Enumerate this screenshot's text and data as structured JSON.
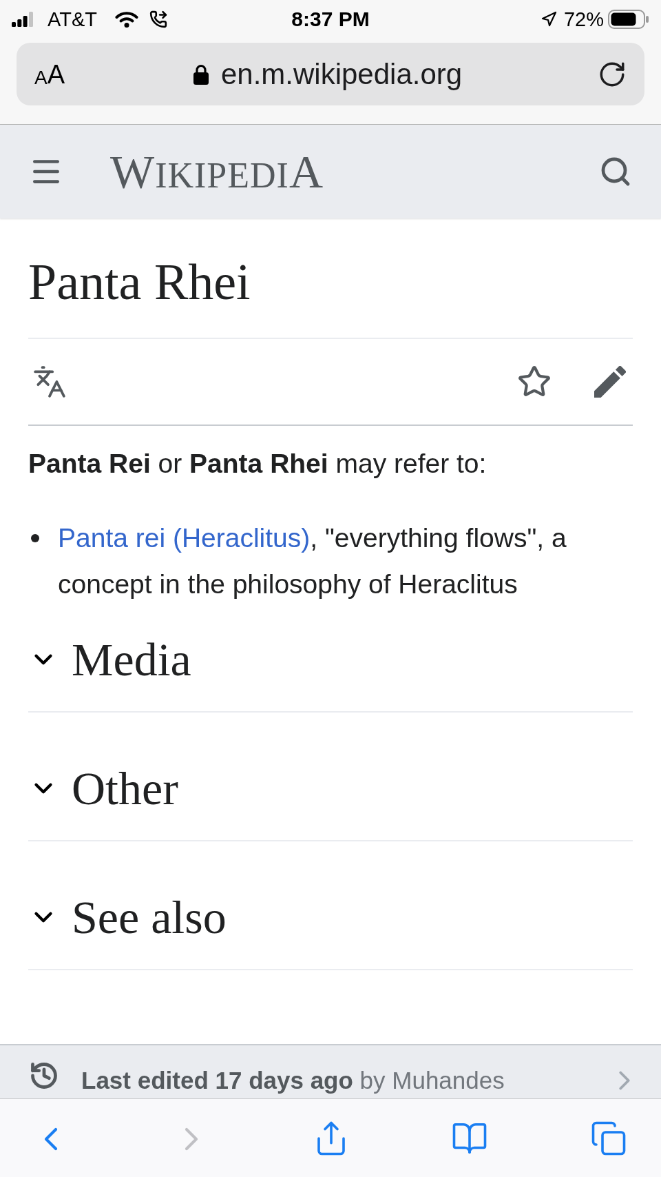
{
  "status_bar": {
    "carrier": "AT&T",
    "time": "8:37 PM",
    "battery": "72%"
  },
  "address_bar": {
    "text_size_button": "AA",
    "url": "en.m.wikipedia.org"
  },
  "site_header": {
    "wordmark": "WIKIPEDIA"
  },
  "article": {
    "title": "Panta Rhei",
    "watched": false,
    "intro": "**Panta Rei** or **Panta Rhei** may refer to:",
    "list": [
      {
        "link": "Panta rei (Heraclitus)",
        "text": ", \"everything flows\", a concept in the philosophy of Heraclitus"
      }
    ],
    "sections": [
      {
        "heading": "Media",
        "expanded": false
      },
      {
        "heading": "Other",
        "expanded": false
      },
      {
        "heading": "See also",
        "expanded": false
      }
    ]
  },
  "footer": {
    "last_edited": "**Last edited 17 days ago** by Muhandes"
  },
  "toolbar": [
    {
      "kind": "back",
      "disabled": false
    },
    {
      "kind": "forward",
      "disabled": true
    },
    {
      "kind": "share",
      "disabled": false
    },
    {
      "kind": "bookmarks",
      "disabled": false
    },
    {
      "kind": "tabs",
      "disabled": false
    }
  ]
}
